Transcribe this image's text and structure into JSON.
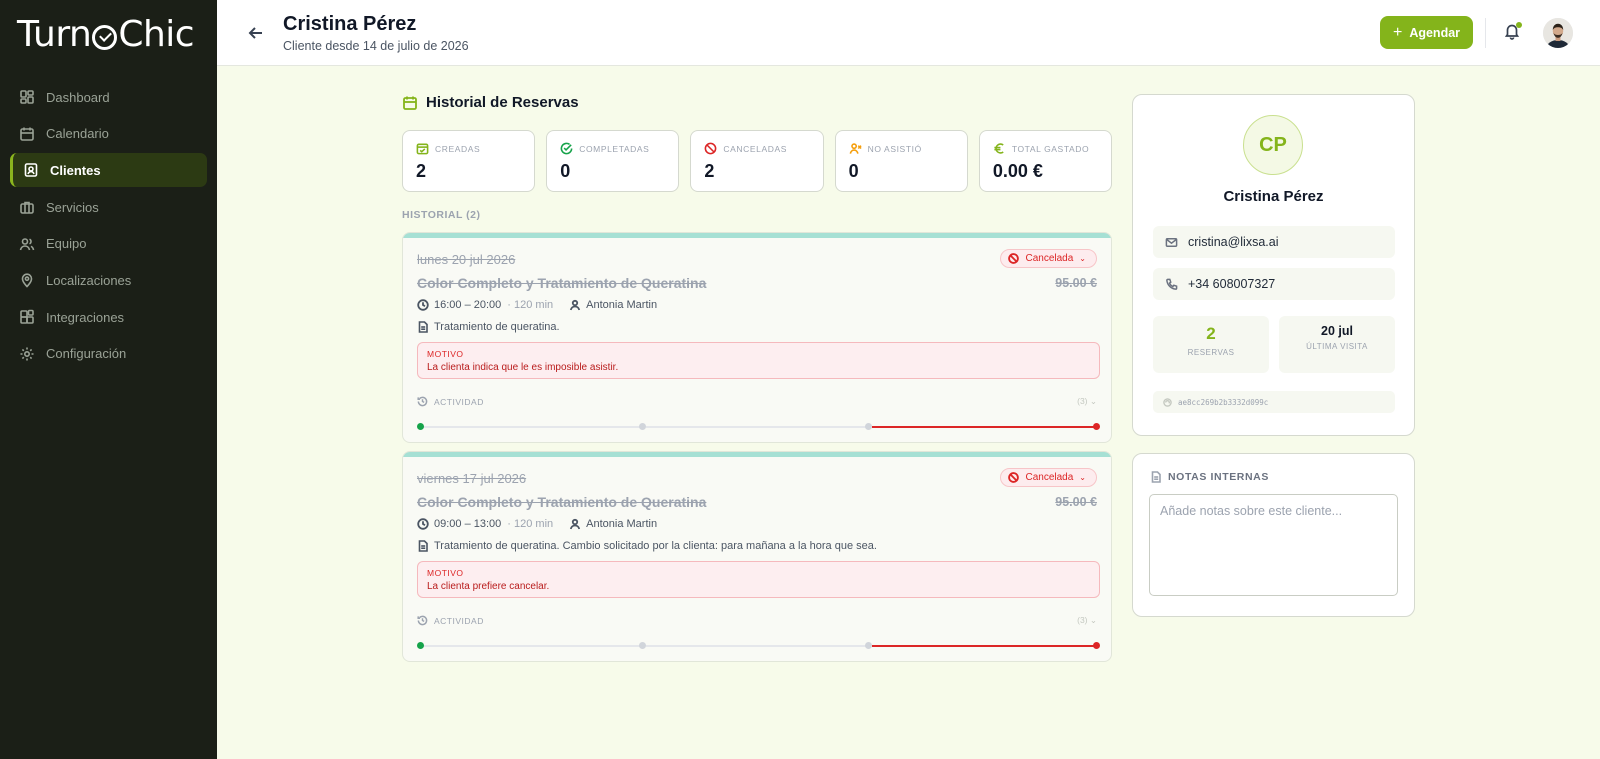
{
  "app": {
    "logo_prefix": "Turn",
    "logo_suffix": "Chic"
  },
  "sidebar": {
    "items": [
      {
        "label": "Dashboard",
        "icon": "dashboard-icon"
      },
      {
        "label": "Calendario",
        "icon": "calendar-icon"
      },
      {
        "label": "Clientes",
        "icon": "clients-icon",
        "active": true
      },
      {
        "label": "Servicios",
        "icon": "briefcase-icon"
      },
      {
        "label": "Equipo",
        "icon": "team-icon"
      },
      {
        "label": "Localizaciones",
        "icon": "location-pin-icon"
      },
      {
        "label": "Integraciones",
        "icon": "integrations-icon"
      },
      {
        "label": "Configuración",
        "icon": "gear-icon"
      }
    ]
  },
  "header": {
    "title": "Cristina Pérez",
    "subtitle": "Cliente desde 14 de julio de 2026",
    "agendar_label": "Agendar"
  },
  "history": {
    "title": "Historial de Reservas",
    "list_label": "HISTORIAL (2)",
    "stats": [
      {
        "label": "CREADAS",
        "value": "2",
        "icon": "calendar-check-icon",
        "color": "#84b41b"
      },
      {
        "label": "COMPLETADAS",
        "value": "0",
        "icon": "check-circle-icon",
        "color": "#16a34a"
      },
      {
        "label": "CANCELADAS",
        "value": "2",
        "icon": "ban-icon",
        "color": "#dc2626"
      },
      {
        "label": "NO ASISTIÓ",
        "value": "0",
        "icon": "user-x-icon",
        "color": "#f59e0b"
      },
      {
        "label": "TOTAL GASTADO",
        "value": "0.00 €",
        "icon": "euro-icon",
        "color": "#84b41b"
      }
    ],
    "bookings": [
      {
        "date": "lunes 20 jul 2026",
        "status": "Cancelada",
        "service": "Color Completo y Tratamiento de Queratina",
        "price": "95.00 €",
        "time": "16:00 – 20:00",
        "duration": "· 120 min",
        "staff": "Antonia Martin",
        "note": "Tratamiento de queratina.",
        "reason_label": "MOTIVO",
        "reason": "La clienta indica que le es imposible asistir.",
        "activity_label": "ACTIVIDAD",
        "activity_count": "(3)"
      },
      {
        "date": "viernes 17 jul 2026",
        "status": "Cancelada",
        "service": "Color Completo y Tratamiento de Queratina",
        "price": "95.00 €",
        "time": "09:00 – 13:00",
        "duration": "· 120 min",
        "staff": "Antonia Martin",
        "note": "Tratamiento de queratina. Cambio solicitado por la clienta: para mañana a la hora que sea.",
        "reason_label": "MOTIVO",
        "reason": "La clienta prefiere cancelar.",
        "activity_label": "ACTIVIDAD",
        "activity_count": "(3)"
      }
    ]
  },
  "profile": {
    "initials": "CP",
    "name": "Cristina Pérez",
    "email": "cristina@lixsa.ai",
    "phone": "+34 608007327",
    "bookings_count": "2",
    "bookings_label": "RESERVAS",
    "last_visit": "20 jul",
    "last_visit_label": "ÚLTIMA VISITA",
    "id": "ae8cc269b2b3332d099c"
  },
  "notes": {
    "title": "NOTAS INTERNAS",
    "placeholder": "Añade notas sobre este cliente..."
  },
  "colors": {
    "accent": "#84b41b",
    "sidebar": "#1b1f17",
    "cancel": "#dc2626",
    "booking_bar": "#a6e0d4"
  }
}
